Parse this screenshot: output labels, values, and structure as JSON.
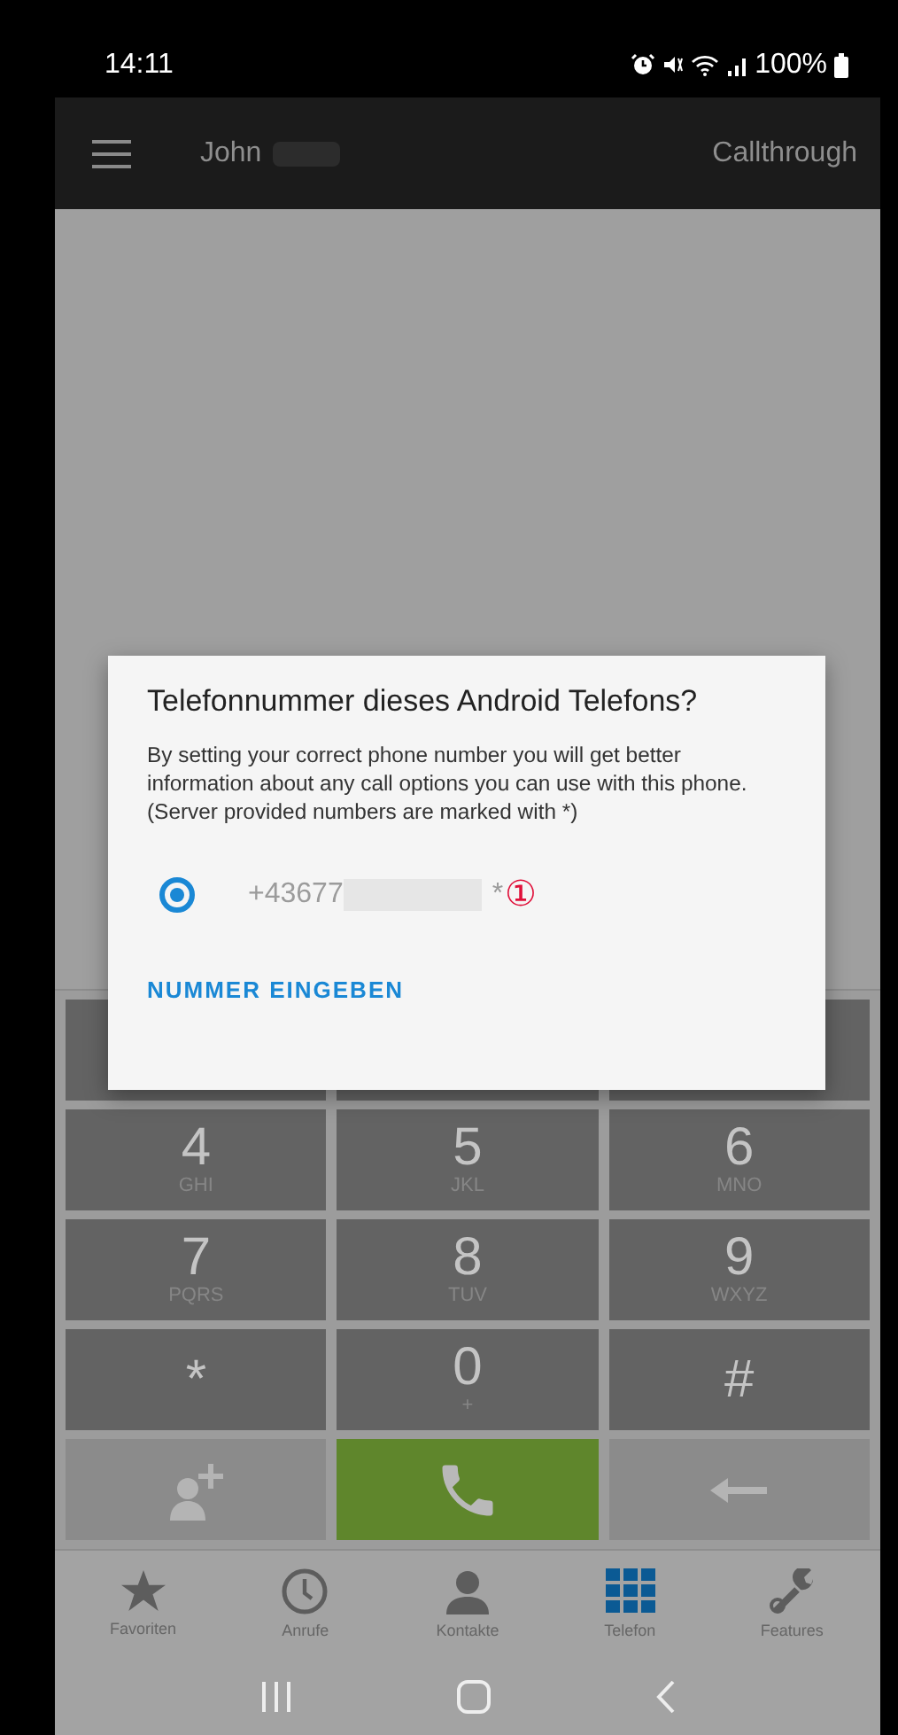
{
  "status_bar": {
    "time": "14:11",
    "battery": "100%"
  },
  "app_bar": {
    "user": "John",
    "title": "Callthrough"
  },
  "dialog": {
    "title": "Telefonnummer dieses Android Telefons?",
    "message": "By setting your correct phone number you will get better information about any call options you can use with this phone.\n(Server provided numbers are marked with *)",
    "options": [
      {
        "number": "+43677",
        "suffix": "*",
        "marker": "①",
        "selected": true
      }
    ],
    "action": "NUMMER EINGEBEN"
  },
  "keypad": [
    {
      "kind": "hidden"
    },
    {
      "kind": "hidden"
    },
    {
      "kind": "hidden"
    },
    {
      "kind": "digit",
      "digit": "4",
      "letters": "GHI"
    },
    {
      "kind": "digit",
      "digit": "5",
      "letters": "JKL"
    },
    {
      "kind": "digit",
      "digit": "6",
      "letters": "MNO"
    },
    {
      "kind": "digit",
      "digit": "7",
      "letters": "PQRS"
    },
    {
      "kind": "digit",
      "digit": "8",
      "letters": "TUV"
    },
    {
      "kind": "digit",
      "digit": "9",
      "letters": "WXYZ"
    },
    {
      "kind": "digit",
      "digit": "*"
    },
    {
      "kind": "digit",
      "digit": "0",
      "letters": "+"
    },
    {
      "kind": "digit",
      "digit": "#"
    },
    {
      "kind": "add-contact"
    },
    {
      "kind": "call"
    },
    {
      "kind": "backspace"
    }
  ],
  "bottom_nav": [
    {
      "label": "Favoriten",
      "kind": "star",
      "selected": false
    },
    {
      "label": "Anrufe",
      "kind": "clock",
      "selected": false
    },
    {
      "label": "Kontakte",
      "kind": "person",
      "selected": false
    },
    {
      "label": "Telefon",
      "kind": "grid",
      "selected": true
    },
    {
      "label": "Features",
      "kind": "wrench",
      "selected": false
    }
  ]
}
